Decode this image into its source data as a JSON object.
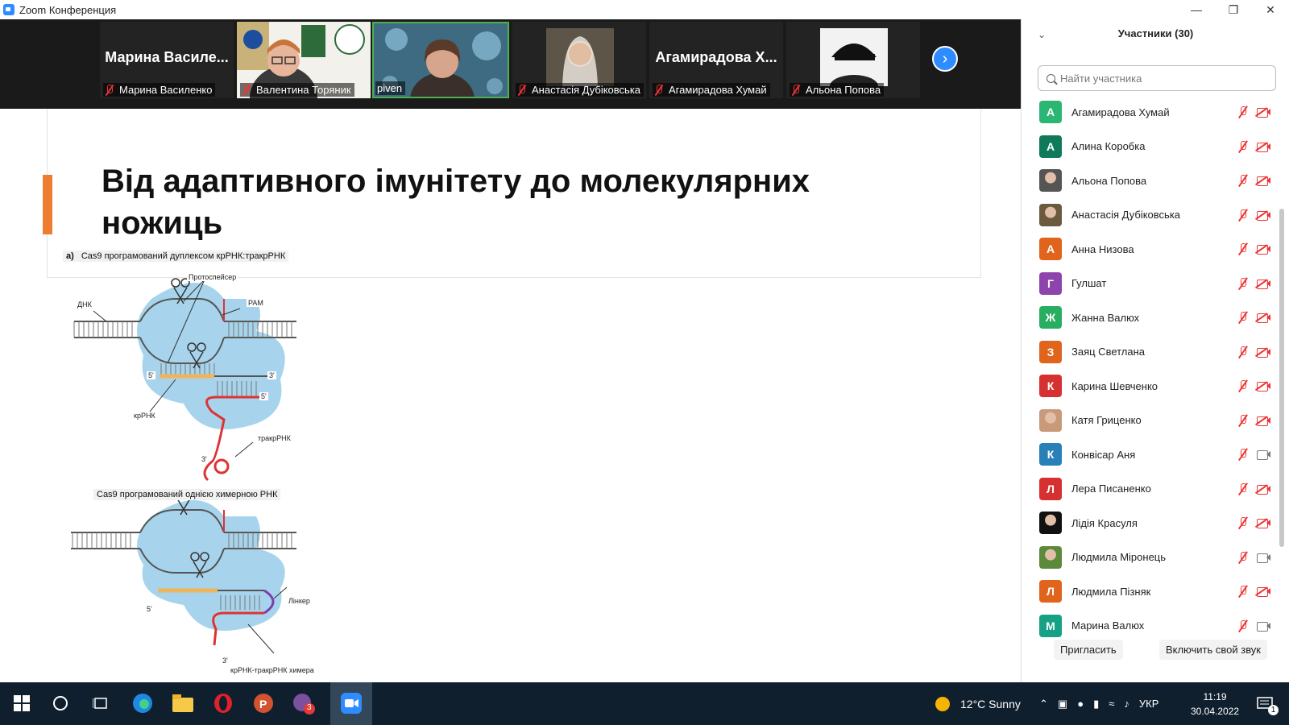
{
  "window": {
    "title": "Zoom Конференция"
  },
  "video_tiles": [
    {
      "bigname": "Марина  Василе...",
      "label": "Марина Василенко"
    },
    {
      "label": "Валентина Торяник"
    },
    {
      "label": "piven"
    },
    {
      "label": "Анастасія Дубіковська"
    },
    {
      "bigname": "Агамирадова  Х...",
      "label": "Агамирадова Хумай"
    },
    {
      "label": "Альона Попова"
    }
  ],
  "slide": {
    "title": "Від адаптивного імунітету до молекулярних ножиць",
    "figure": {
      "caption_a_prefix": "а)",
      "caption_a": "Cas9 програмований дуплексом крРНК:тракрРНК",
      "caption_b": "Cas9 програмований однією химерною РНК",
      "labels": {
        "protospacer": "Протоспейсер",
        "dna": "ДНК",
        "pam": "РАМ",
        "crrna": "крРНК",
        "tracrrna": "тракрРНК",
        "linker": "Лінкер",
        "chimera": "крРНК-тракрРНК химера",
        "five1": "5'",
        "three1": "3'",
        "five2": "5'",
        "three2": "3'",
        "five3": "5'",
        "three3": "3'"
      }
    }
  },
  "participants_panel": {
    "title": "Участники (30)",
    "search_placeholder": "Найти участника",
    "participants": [
      {
        "initial": "А",
        "name": "Агамирадова Хумай",
        "color": "#2bb673",
        "video": "off"
      },
      {
        "initial": "А",
        "name": "Алина Коробка",
        "color": "#0f7a5a",
        "video": "off"
      },
      {
        "initial": "",
        "name": "Альона Попова",
        "color": "#555555",
        "video": "off",
        "photo": true
      },
      {
        "initial": "",
        "name": "Анастасія Дубіковська",
        "color": "#6b5a3e",
        "video": "off",
        "photo": true
      },
      {
        "initial": "А",
        "name": "Анна Низова",
        "color": "#e0641c",
        "video": "off"
      },
      {
        "initial": "Г",
        "name": "Гулшат",
        "color": "#8e44ad",
        "video": "off"
      },
      {
        "initial": "Ж",
        "name": "Жанна Валюх",
        "color": "#27ae60",
        "video": "off"
      },
      {
        "initial": "З",
        "name": "Заяц Светлана",
        "color": "#e0641c",
        "video": "off"
      },
      {
        "initial": "К",
        "name": "Карина Шевченко",
        "color": "#d63031",
        "video": "off"
      },
      {
        "initial": "",
        "name": "Катя Гриценко",
        "color": "#c89a7a",
        "video": "off",
        "photo": true
      },
      {
        "initial": "К",
        "name": "Конвісар Аня",
        "color": "#2980b9",
        "video": "on"
      },
      {
        "initial": "Л",
        "name": "Лера Писаненко",
        "color": "#d63031",
        "video": "off"
      },
      {
        "initial": "",
        "name": "Лідія Красуля",
        "color": "#111111",
        "video": "off",
        "photo": true
      },
      {
        "initial": "",
        "name": "Людмила Міронець",
        "color": "#5a8a3a",
        "video": "on",
        "photo": true
      },
      {
        "initial": "Л",
        "name": "Людмила Пізняк",
        "color": "#e0641c",
        "video": "off"
      },
      {
        "initial": "М",
        "name": "Марина Валюх",
        "color": "#16a085",
        "video": "on"
      }
    ],
    "invite_label": "Пригласить",
    "unmute_label": "Включить свой звук"
  },
  "taskbar": {
    "weather": "12°C  Sunny",
    "language": "УКР",
    "time": "11:19",
    "date": "30.04.2022",
    "viber_badge": "3",
    "notification_badge": "1"
  }
}
